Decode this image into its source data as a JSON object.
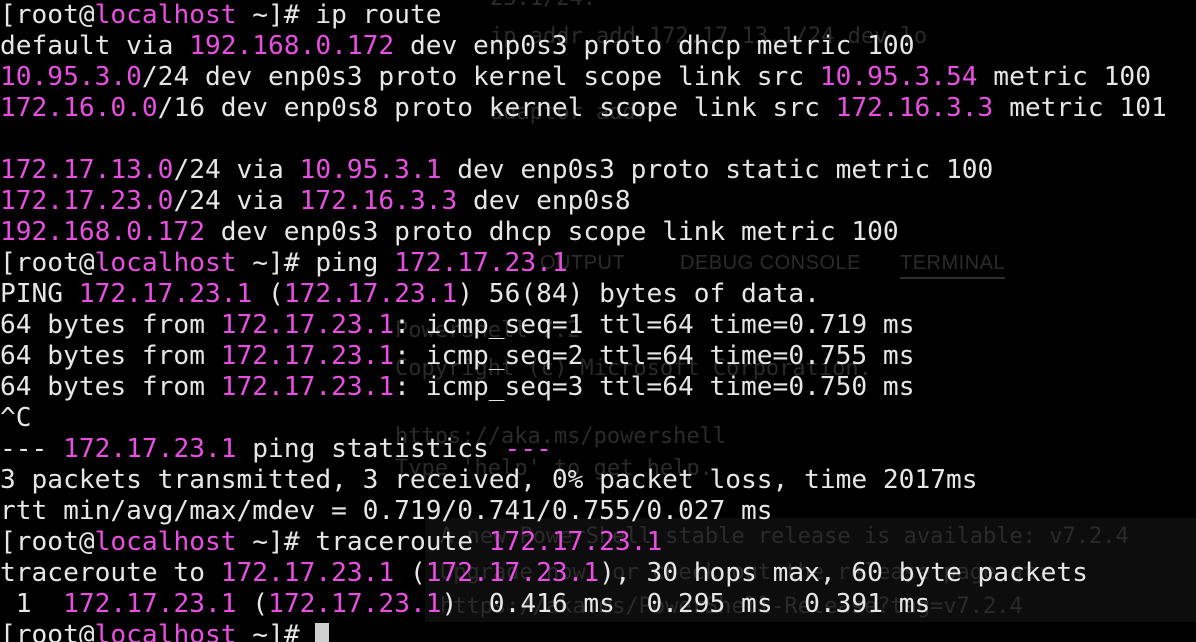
{
  "terminal": {
    "lines": [
      [
        {
          "t": "[root@",
          "c": "d"
        },
        {
          "t": "localhost",
          "c": "m"
        },
        {
          "t": " ~]# ip route",
          "c": "d"
        }
      ],
      [
        {
          "t": "default via ",
          "c": "d"
        },
        {
          "t": "192.168.0.172",
          "c": "m"
        },
        {
          "t": " dev enp0s3 proto dhcp metric 100",
          "c": "d"
        }
      ],
      [
        {
          "t": "10.95.3.0",
          "c": "m"
        },
        {
          "t": "/24 dev enp0s3 proto kernel scope link src ",
          "c": "d"
        },
        {
          "t": "10.95.3.54",
          "c": "m"
        },
        {
          "t": " metric 100",
          "c": "d"
        }
      ],
      [
        {
          "t": "172.16.0.0",
          "c": "m"
        },
        {
          "t": "/16 dev enp0s8 proto kernel scope link src ",
          "c": "d"
        },
        {
          "t": "172.16.3.3",
          "c": "m"
        },
        {
          "t": " metric 101",
          "c": "d"
        }
      ],
      [
        {
          "t": "",
          "c": "d"
        }
      ],
      [
        {
          "t": "172.17.13.0",
          "c": "m"
        },
        {
          "t": "/24 via ",
          "c": "d"
        },
        {
          "t": "10.95.3.1",
          "c": "m"
        },
        {
          "t": " dev enp0s3 proto static metric 100",
          "c": "d"
        }
      ],
      [
        {
          "t": "172.17.23.0",
          "c": "m"
        },
        {
          "t": "/24 via ",
          "c": "d"
        },
        {
          "t": "172.16.3.3",
          "c": "m"
        },
        {
          "t": " dev enp0s8",
          "c": "d"
        }
      ],
      [
        {
          "t": "192.168.0.172",
          "c": "m"
        },
        {
          "t": " dev enp0s3 proto dhcp scope link metric 100",
          "c": "d"
        }
      ],
      [
        {
          "t": "[root@",
          "c": "d"
        },
        {
          "t": "localhost",
          "c": "m"
        },
        {
          "t": " ~]# ping ",
          "c": "d"
        },
        {
          "t": "172.17.23.1",
          "c": "m"
        }
      ],
      [
        {
          "t": "PING ",
          "c": "d"
        },
        {
          "t": "172.17.23.1",
          "c": "m"
        },
        {
          "t": " (",
          "c": "d"
        },
        {
          "t": "172.17.23.1",
          "c": "m"
        },
        {
          "t": ") 56(84) bytes of data.",
          "c": "d"
        }
      ],
      [
        {
          "t": "64 bytes from ",
          "c": "d"
        },
        {
          "t": "172.17.23.1",
          "c": "m"
        },
        {
          "t": ": icmp_seq=1 ttl=64 time=0.719 ms",
          "c": "d"
        }
      ],
      [
        {
          "t": "64 bytes from ",
          "c": "d"
        },
        {
          "t": "172.17.23.1",
          "c": "m"
        },
        {
          "t": ": icmp_seq=2 ttl=64 time=0.755 ms",
          "c": "d"
        }
      ],
      [
        {
          "t": "64 bytes from ",
          "c": "d"
        },
        {
          "t": "172.17.23.1",
          "c": "m"
        },
        {
          "t": ": icmp_seq=3 ttl=64 time=0.750 ms",
          "c": "d"
        }
      ],
      [
        {
          "t": "^C",
          "c": "d"
        }
      ],
      [
        {
          "t": "--- ",
          "c": "d"
        },
        {
          "t": "172.17.23.1",
          "c": "m"
        },
        {
          "t": " ping statistics ",
          "c": "d"
        },
        {
          "t": "---",
          "c": "m"
        }
      ],
      [
        {
          "t": "3 packets transmitted, 3 received, 0% packet loss, time 2017ms",
          "c": "d"
        }
      ],
      [
        {
          "t": "rtt min/avg/max/mdev = 0.719/0.741/0.755/0.027 ms",
          "c": "d"
        }
      ],
      [
        {
          "t": "[root@",
          "c": "d"
        },
        {
          "t": "localhost",
          "c": "m"
        },
        {
          "t": " ~]# traceroute ",
          "c": "d"
        },
        {
          "t": "172.17.23.1",
          "c": "m"
        }
      ],
      [
        {
          "t": "traceroute to ",
          "c": "d"
        },
        {
          "t": "172.17.23.1",
          "c": "m"
        },
        {
          "t": " (",
          "c": "d"
        },
        {
          "t": "172.17.23.1",
          "c": "m"
        },
        {
          "t": "), 30 hops max, 60 byte packets",
          "c": "d"
        }
      ],
      [
        {
          "t": " 1  ",
          "c": "d"
        },
        {
          "t": "172.17.23.1",
          "c": "m"
        },
        {
          "t": " (",
          "c": "d"
        },
        {
          "t": "172.17.23.1",
          "c": "m"
        },
        {
          "t": ")  0.416 ms  0.295 ms  0.391 ms",
          "c": "d"
        }
      ],
      [
        {
          "t": "[root@",
          "c": "d"
        },
        {
          "t": "localhost",
          "c": "m"
        },
        {
          "t": " ~]# ",
          "c": "d"
        }
      ]
    ]
  },
  "background_window": {
    "lines": [
      "23.1/24.",
      "ip addr add 172.17.13.1/24 dev lo",
      "",
      "adaptor addr",
      "PowerShell 7.2",
      "Copyright (c) Microsoft Corporation.",
      "https://aka.ms/powershell",
      "Type 'help' to get help.",
      "A new PowerShell stable release is available: v7.2.4",
      "Upgrade now, or check out the release page at:",
      "https://aka.ms/PowerShell-Release?tag=v7.2.4"
    ],
    "tabs": [
      "OUTPUT",
      "DEBUG CONSOLE",
      "TERMINAL"
    ]
  },
  "colors": {
    "background": "#000000",
    "text": "#e6e6e6",
    "highlight": "#e84ee0",
    "cursor": "#cfcfcf"
  }
}
